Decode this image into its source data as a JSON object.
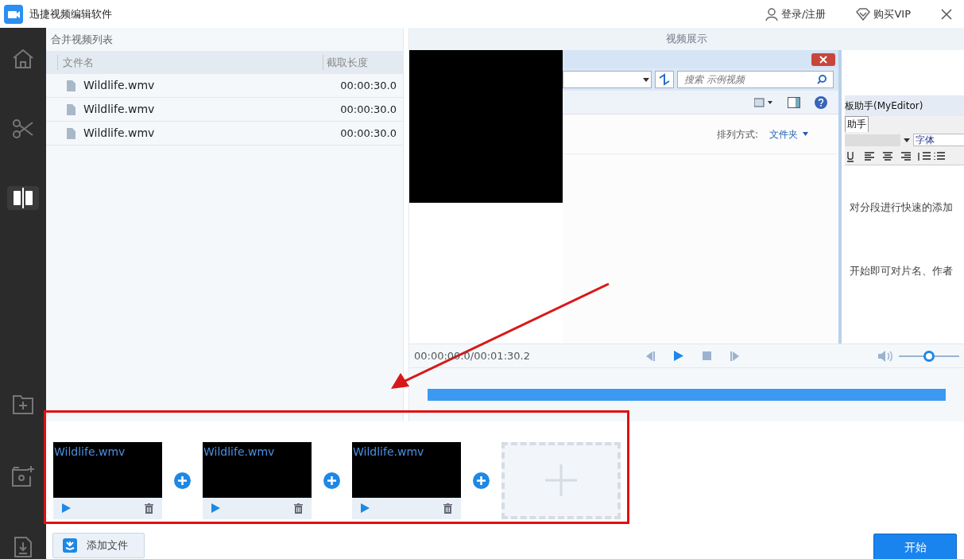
{
  "window": {
    "title": "迅捷视频编辑软件"
  },
  "header_actions": [
    {
      "kind": "user",
      "label": "登录/注册"
    },
    {
      "kind": "vip",
      "label": "购买VIP"
    }
  ],
  "sidebar": {
    "items": [
      {
        "kind": "home",
        "selected": false
      },
      {
        "kind": "cut",
        "selected": false
      },
      {
        "kind": "merge",
        "selected": true
      },
      {
        "kind": "add-folder",
        "selected": false
      },
      {
        "kind": "settings-folder",
        "selected": false
      },
      {
        "kind": "download",
        "selected": false
      }
    ]
  },
  "file_list": {
    "title": "合并视频列表",
    "columns": [
      "文件名",
      "截取长度"
    ],
    "rows": [
      {
        "name": "Wildlife.wmv",
        "duration": "00:00:30.0"
      },
      {
        "name": "Wildlife.wmv",
        "duration": "00:00:30.0"
      },
      {
        "name": "Wildlife.wmv",
        "duration": "00:00:30.0"
      }
    ]
  },
  "preview": {
    "title": "视频展示",
    "frame": {
      "search_placeholder": "搜索 示例视频",
      "sort_label": "排列方式:",
      "sort_value": "文件夹",
      "editor_title": "板助手(MyEditor)",
      "editor_tab": "助手",
      "font_field": "字体",
      "text_lines": [
        "对分段进行快速的添加",
        "开始即可对片名、作者"
      ]
    },
    "time": "00:00:00.0/00:01:30.2",
    "volume": {
      "level": 0.5
    },
    "progress": {
      "level": 1
    }
  },
  "clips": [
    {
      "name": "Wildlife.wmv"
    },
    {
      "name": "Wildlife.wmv"
    },
    {
      "name": "Wildlife.wmv"
    }
  ],
  "buttons": {
    "add_file": "添加文件",
    "start": "开始"
  }
}
